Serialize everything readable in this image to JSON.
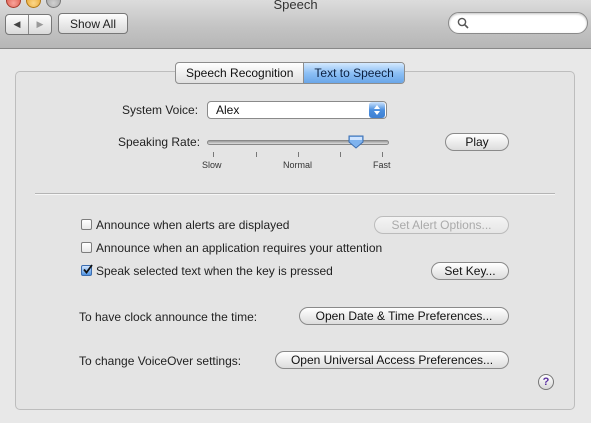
{
  "window": {
    "title": "Speech"
  },
  "toolbar": {
    "back_glyph": "◀",
    "forward_glyph": "▶",
    "show_all_label": "Show All",
    "search": {
      "value": "",
      "placeholder": ""
    }
  },
  "tabs": [
    {
      "label": "Speech Recognition",
      "selected": false
    },
    {
      "label": "Text to Speech",
      "selected": true
    }
  ],
  "voice": {
    "label": "System Voice:",
    "value": "Alex"
  },
  "rate": {
    "label": "Speaking Rate:",
    "level": 0.82,
    "ticks": [
      "Slow",
      "Normal",
      "Fast"
    ]
  },
  "play_label": "Play",
  "options": [
    {
      "label": "Announce when alerts are displayed",
      "checked": false
    },
    {
      "label": "Announce when an application requires your attention",
      "checked": false
    },
    {
      "label": "Speak selected text when the key is pressed",
      "checked": true
    }
  ],
  "set_alert_options_label": "Set Alert Options...",
  "set_key_label": "Set Key...",
  "clock": {
    "label": "To have clock announce the time:",
    "button": "Open Date & Time Preferences..."
  },
  "voiceover": {
    "label": "To change VoiceOver settings:",
    "button": "Open Universal Access Preferences..."
  },
  "help_glyph": "?",
  "colors": {
    "accent": "#6aa6e8",
    "window_bg": "#e8e8e8"
  }
}
